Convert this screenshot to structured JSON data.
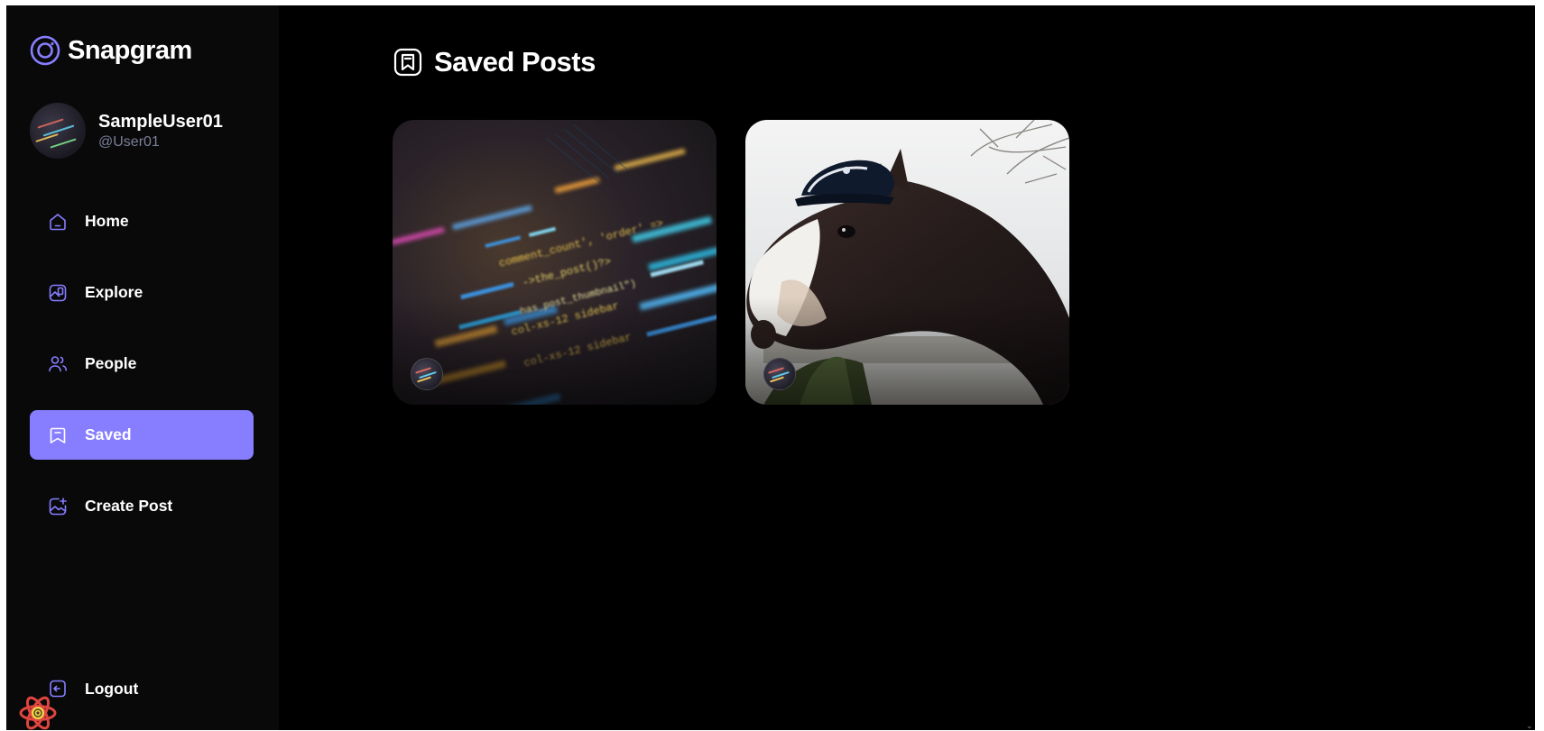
{
  "app": {
    "name": "Snapgram",
    "logo_icon": "snapgram-logo-icon",
    "accent_color": "#877eff",
    "background_color": "#000000",
    "sidebar_color": "#09090a"
  },
  "profile": {
    "name": "SampleUser01",
    "handle": "@User01"
  },
  "sidebar": {
    "items": [
      {
        "label": "Home",
        "icon": "home-icon",
        "active": false
      },
      {
        "label": "Explore",
        "icon": "gallery-icon",
        "active": false
      },
      {
        "label": "People",
        "icon": "people-icon",
        "active": false
      },
      {
        "label": "Saved",
        "icon": "bookmark-icon",
        "active": true
      },
      {
        "label": "Create Post",
        "icon": "gallery-add-icon",
        "active": false
      }
    ],
    "logout_label": "Logout",
    "logout_icon": "logout-icon"
  },
  "main": {
    "title": "Saved Posts",
    "title_icon": "bookmark-icon",
    "posts": [
      {
        "image": "code-editor-photo",
        "creator_avatar": "avatar"
      },
      {
        "image": "horse-wearing-cap-photo",
        "creator_avatar": "avatar"
      }
    ]
  },
  "devtools": {
    "badge_icon": "react-icon"
  }
}
